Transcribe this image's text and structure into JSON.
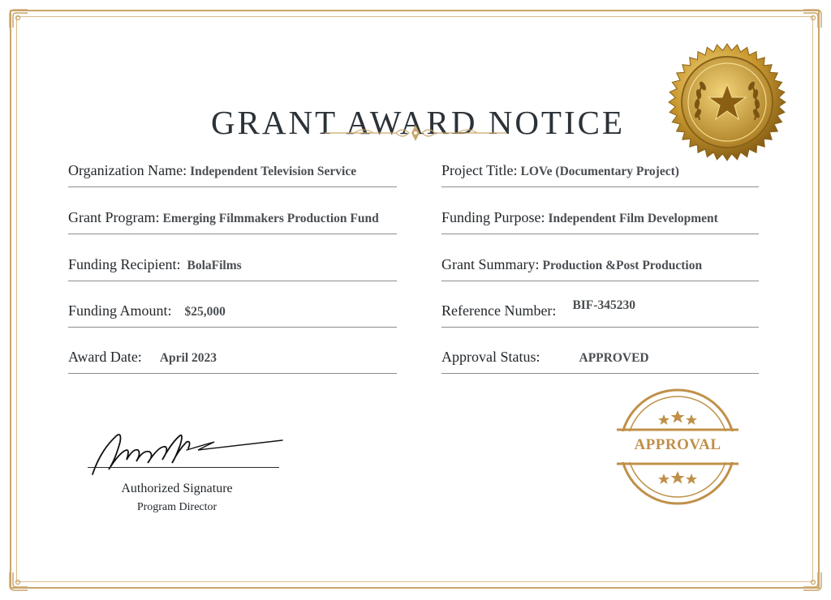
{
  "document": {
    "title": "GRANT AWARD NOTICE"
  },
  "fields_left": [
    {
      "label": "Organization Name:",
      "value": "Independent Television Service"
    },
    {
      "label": "Grant Program:",
      "value": "Emerging Filmmakers Production Fund"
    },
    {
      "label": "Funding Recipient:",
      "value": "BolaFilms"
    },
    {
      "label": "Funding Amount:",
      "value": "$25,000"
    },
    {
      "label": "Award Date:",
      "value": "April 2023"
    }
  ],
  "fields_right": [
    {
      "label": "Project Title:",
      "value": "LOVe (Documentary Project)"
    },
    {
      "label": "Funding Purpose:",
      "value": "Independent Film Development"
    },
    {
      "label": "Grant Summary:",
      "value": "Production &Post Production"
    },
    {
      "label": "Reference Number:",
      "value": "BIF-345230"
    },
    {
      "label": "Approval Status:",
      "value": "APPROVED"
    }
  ],
  "signature": {
    "label": "Authorized Signature",
    "title": "Program Director"
  },
  "stamp": {
    "text": "APPROVAL"
  },
  "colors": {
    "gold": "#c9a66b",
    "stamp_gold": "#c09048",
    "text_dark": "#23282c",
    "value_gray": "#4a4e52"
  },
  "icons": {
    "seal": "gold-star-laurel-seal-icon",
    "stamp": "approval-stamp-icon",
    "flourish": "ornamental-divider-icon"
  }
}
